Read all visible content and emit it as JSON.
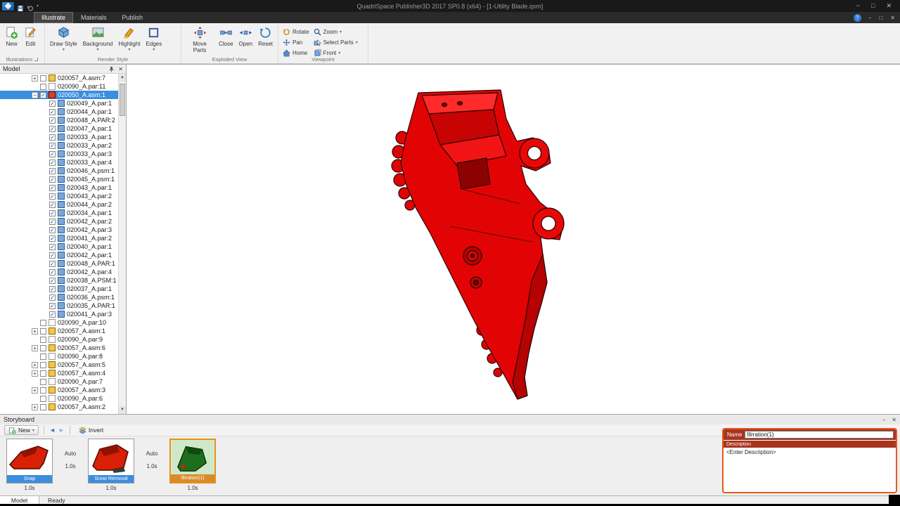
{
  "glyphs": {
    "minimize": "−",
    "maximize": "□",
    "close": "✕",
    "help": "?",
    "dropdown": "▾",
    "plus": "+",
    "minus": "−",
    "check": "✓",
    "scroll_up": "▲",
    "scroll_down": "▼",
    "back": "◄",
    "forward": "►"
  },
  "colors": {
    "selection_blue": "#3b8ede",
    "accent_orange": "#e55a1e",
    "model_red": "#e20404"
  },
  "titlebar": {
    "title": "QuadriSpace Publisher3D  2017 SP0.8 (x64)  - [1-Utility Blade.qsm]"
  },
  "ribbon_tabs": [
    {
      "label": "Illustrate",
      "active": true
    },
    {
      "label": "Materials",
      "active": false
    },
    {
      "label": "Publish",
      "active": false
    }
  ],
  "ribbon": {
    "illustrations": {
      "group_label": "Illustrations",
      "new": "New",
      "edit": "Edit"
    },
    "render_style": {
      "group_label": "Render Style",
      "draw_style": "Draw Style",
      "background": "Background",
      "highlight": "Highlight",
      "edges": "Edges"
    },
    "exploded_view": {
      "group_label": "Exploded View",
      "move_parts": "Move Parts",
      "close": "Close",
      "open": "Open",
      "reset": "Reset"
    },
    "viewpoint": {
      "group_label": "Viewpoint",
      "rotate": "Rotate",
      "pan": "Pan",
      "home": "Home",
      "zoom": "Zoom",
      "select_parts": "Select Parts",
      "front": "Front"
    }
  },
  "model_panel": {
    "title": "Model",
    "items": [
      {
        "label": "020057_A.asm:7",
        "icon": "asm",
        "checked": false,
        "expander": "+",
        "indent": 0,
        "selected": false
      },
      {
        "label": "020090_A.par:11",
        "icon": "page",
        "checked": false,
        "expander": "",
        "indent": 0,
        "selected": false
      },
      {
        "label": "020050_A.asm:1",
        "icon": "asm",
        "checked": true,
        "expander": "-",
        "indent": 0,
        "selected": true
      },
      {
        "label": "020049_A.par:1",
        "icon": "part",
        "checked": true,
        "expander": "",
        "indent": 1,
        "selected": false
      },
      {
        "label": "020044_A.par:1",
        "icon": "part",
        "checked": true,
        "expander": "",
        "indent": 1,
        "selected": false
      },
      {
        "label": "020048_A.PAR:2",
        "icon": "part",
        "checked": true,
        "expander": "",
        "indent": 1,
        "selected": false
      },
      {
        "label": "020047_A.par:1",
        "icon": "part",
        "checked": true,
        "expander": "",
        "indent": 1,
        "selected": false
      },
      {
        "label": "020033_A.par:1",
        "icon": "part",
        "checked": true,
        "expander": "",
        "indent": 1,
        "selected": false
      },
      {
        "label": "020033_A.par:2",
        "icon": "part",
        "checked": true,
        "expander": "",
        "indent": 1,
        "selected": false
      },
      {
        "label": "020033_A.par:3",
        "icon": "part",
        "checked": true,
        "expander": "",
        "indent": 1,
        "selected": false
      },
      {
        "label": "020033_A.par:4",
        "icon": "part",
        "checked": true,
        "expander": "",
        "indent": 1,
        "selected": false
      },
      {
        "label": "020046_A.psm:1",
        "icon": "part",
        "checked": true,
        "expander": "",
        "indent": 1,
        "selected": false
      },
      {
        "label": "020045_A.psm:1",
        "icon": "part",
        "checked": true,
        "expander": "",
        "indent": 1,
        "selected": false
      },
      {
        "label": "020043_A.par:1",
        "icon": "part",
        "checked": true,
        "expander": "",
        "indent": 1,
        "selected": false
      },
      {
        "label": "020043_A.par:2",
        "icon": "part",
        "checked": true,
        "expander": "",
        "indent": 1,
        "selected": false
      },
      {
        "label": "020044_A.par:2",
        "icon": "part",
        "checked": true,
        "expander": "",
        "indent": 1,
        "selected": false
      },
      {
        "label": "020034_A.par:1",
        "icon": "part",
        "checked": true,
        "expander": "",
        "indent": 1,
        "selected": false
      },
      {
        "label": "020042_A.par:2",
        "icon": "part",
        "checked": true,
        "expander": "",
        "indent": 1,
        "selected": false
      },
      {
        "label": "020042_A.par:3",
        "icon": "part",
        "checked": true,
        "expander": "",
        "indent": 1,
        "selected": false
      },
      {
        "label": "020041_A.par:2",
        "icon": "part",
        "checked": true,
        "expander": "",
        "indent": 1,
        "selected": false
      },
      {
        "label": "020040_A.par:1",
        "icon": "part",
        "checked": true,
        "expander": "",
        "indent": 1,
        "selected": false
      },
      {
        "label": "020042_A.par:1",
        "icon": "part",
        "checked": true,
        "expander": "",
        "indent": 1,
        "selected": false
      },
      {
        "label": "020048_A.PAR:1",
        "icon": "part",
        "checked": true,
        "expander": "",
        "indent": 1,
        "selected": false
      },
      {
        "label": "020042_A.par:4",
        "icon": "part",
        "checked": true,
        "expander": "",
        "indent": 1,
        "selected": false
      },
      {
        "label": "020038_A.PSM:1",
        "icon": "part",
        "checked": true,
        "expander": "",
        "indent": 1,
        "selected": false
      },
      {
        "label": "020037_A.par:1",
        "icon": "part",
        "checked": true,
        "expander": "",
        "indent": 1,
        "selected": false
      },
      {
        "label": "020036_A.psm:1",
        "icon": "part",
        "checked": true,
        "expander": "",
        "indent": 1,
        "selected": false
      },
      {
        "label": "020035_A.PAR:1",
        "icon": "part",
        "checked": true,
        "expander": "",
        "indent": 1,
        "selected": false
      },
      {
        "label": "020041_A.par:3",
        "icon": "part",
        "checked": true,
        "expander": "",
        "indent": 1,
        "selected": false
      },
      {
        "label": "020090_A.par:10",
        "icon": "page",
        "checked": false,
        "expander": "",
        "indent": 0,
        "selected": false
      },
      {
        "label": "020057_A.asm:1",
        "icon": "asm",
        "checked": false,
        "expander": "+",
        "indent": 0,
        "selected": false
      },
      {
        "label": "020090_A.par:9",
        "icon": "page",
        "checked": false,
        "expander": "",
        "indent": 0,
        "selected": false
      },
      {
        "label": "020057_A.asm:6",
        "icon": "asm",
        "checked": false,
        "expander": "+",
        "indent": 0,
        "selected": false
      },
      {
        "label": "020090_A.par:8",
        "icon": "page",
        "checked": false,
        "expander": "",
        "indent": 0,
        "selected": false
      },
      {
        "label": "020057_A.asm:5",
        "icon": "asm",
        "checked": false,
        "expander": "+",
        "indent": 0,
        "selected": false
      },
      {
        "label": "020057_A.asm:4",
        "icon": "asm",
        "checked": false,
        "expander": "+",
        "indent": 0,
        "selected": false
      },
      {
        "label": "020090_A.par:7",
        "icon": "page",
        "checked": false,
        "expander": "",
        "indent": 0,
        "selected": false
      },
      {
        "label": "020057_A.asm:3",
        "icon": "asm",
        "checked": false,
        "expander": "+",
        "indent": 0,
        "selected": false
      },
      {
        "label": "020090_A.par:6",
        "icon": "page",
        "checked": false,
        "expander": "",
        "indent": 0,
        "selected": false
      },
      {
        "label": "020057_A.asm:2",
        "icon": "asm",
        "checked": false,
        "expander": "+",
        "indent": 0,
        "selected": false
      }
    ]
  },
  "storyboard": {
    "title": "Storyboard",
    "toolbar": {
      "new": "New",
      "invert": "Invert"
    },
    "frames": [
      {
        "label": "Snap",
        "duration": "1.0s",
        "selected": false,
        "thumb": "red"
      },
      {
        "label": "Snow Removal",
        "duration": "1.0s",
        "selected": false,
        "thumb": "red2"
      },
      {
        "label": "Illrration(1)",
        "duration": "1.0s",
        "selected": true,
        "thumb": "green"
      }
    ],
    "transitions": [
      {
        "mode": "Auto",
        "duration": "1.0s"
      },
      {
        "mode": "Auto",
        "duration": "1.0s"
      }
    ]
  },
  "properties": {
    "name_label": "Name",
    "name_value": "Illrration(1)",
    "description_label": "Description",
    "description_placeholder": "<Enter Description>"
  },
  "statusbar": {
    "model_tab": "Model",
    "ready": "Ready"
  }
}
